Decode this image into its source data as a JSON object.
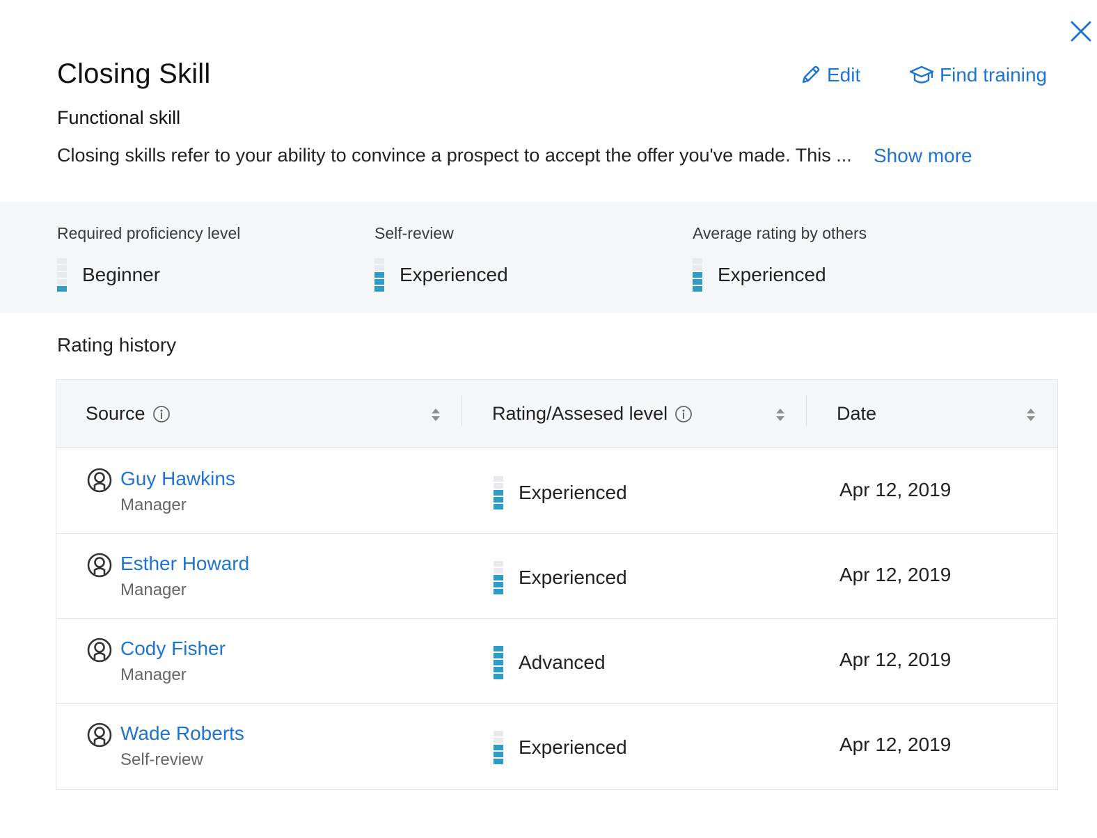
{
  "header": {
    "title": "Closing Skill",
    "edit_label": "Edit",
    "find_training_label": "Find training",
    "subtitle": "Functional skill",
    "description": "Closing skills refer to your ability to convince a prospect to accept the offer you've made. This ...",
    "show_more_label": "Show more"
  },
  "icons": {
    "close": "close-icon",
    "edit": "pencil-icon",
    "training": "graduation-cap-icon",
    "info": "info-icon",
    "sort": "sort-icon",
    "avatar": "user-avatar-icon"
  },
  "colors": {
    "accent": "#1f73d1",
    "level_filled": "#2e9cc6",
    "level_empty": "#e8eaed",
    "summary_bg": "#f5f6f8"
  },
  "summary": {
    "required": {
      "label": "Required proficiency level",
      "value": "Beginner",
      "level": 1,
      "max_level": 5
    },
    "self_review": {
      "label": "Self-review",
      "value": "Experienced",
      "level": 3,
      "max_level": 5
    },
    "average": {
      "label": "Average rating by others",
      "value": "Experienced",
      "level": 3,
      "max_level": 5
    }
  },
  "history": {
    "title": "Rating history",
    "columns": [
      {
        "label": "Source",
        "has_info": true,
        "sortable": true
      },
      {
        "label": "Rating/Assesed level",
        "has_info": true,
        "sortable": true
      },
      {
        "label": "Date",
        "has_info": false,
        "sortable": true
      }
    ],
    "rows": [
      {
        "name": "Guy Hawkins",
        "role": "Manager",
        "rating": "Experienced",
        "level": 3,
        "max_level": 5,
        "date": "Apr 12, 2019"
      },
      {
        "name": "Esther Howard",
        "role": "Manager",
        "rating": "Experienced",
        "level": 3,
        "max_level": 5,
        "date": "Apr 12, 2019"
      },
      {
        "name": "Cody Fisher",
        "role": "Manager",
        "rating": "Advanced",
        "level": 5,
        "max_level": 5,
        "date": "Apr 12, 2019"
      },
      {
        "name": "Wade Roberts",
        "role": "Self-review",
        "rating": "Experienced",
        "level": 3,
        "max_level": 5,
        "date": "Apr 12, 2019"
      }
    ]
  }
}
